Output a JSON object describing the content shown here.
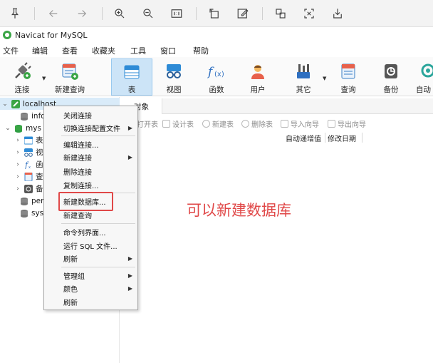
{
  "viewer_toolbar": {
    "icons": [
      "pin-icon",
      "back-icon",
      "forward-icon",
      "zoom-in-icon",
      "zoom-out-icon",
      "actual-size-icon",
      "rotate-icon",
      "edit-icon",
      "crop-icon",
      "fullscreen-icon",
      "save-icon"
    ]
  },
  "window": {
    "title": "Navicat for MySQL"
  },
  "menu": {
    "items": [
      "文件",
      "编辑",
      "查看",
      "收藏夹",
      "工具",
      "窗口",
      "帮助"
    ]
  },
  "ribbon": {
    "buttons": [
      {
        "label": "连接",
        "icon": "connect-icon"
      },
      {
        "label": "新建查询",
        "icon": "new-query-icon"
      },
      {
        "label": "表",
        "icon": "table-icon"
      },
      {
        "label": "视图",
        "icon": "view-icon"
      },
      {
        "label": "函数",
        "icon": "function-icon"
      },
      {
        "label": "用户",
        "icon": "user-icon"
      },
      {
        "label": "其它",
        "icon": "other-icon"
      },
      {
        "label": "查询",
        "icon": "query-icon"
      },
      {
        "label": "备份",
        "icon": "backup-icon"
      },
      {
        "label": "自动",
        "icon": "automation-icon"
      }
    ]
  },
  "tree": {
    "connection": "localhost",
    "items": [
      {
        "label": "info"
      },
      {
        "label": "mys"
      },
      {
        "label": "表"
      },
      {
        "label": "视"
      },
      {
        "label": "函"
      },
      {
        "label": "查"
      },
      {
        "label": "备"
      },
      {
        "label": "per"
      },
      {
        "label": "sys"
      }
    ]
  },
  "object_panel": {
    "tab": "对象",
    "toolbar": [
      "打开表",
      "设计表",
      "新建表",
      "删除表",
      "导入向导",
      "导出向导"
    ],
    "columns": [
      "自动递增值",
      "修改日期"
    ]
  },
  "context_menu": {
    "items": [
      "关闭连接",
      "切换连接配置文件",
      "编辑连接...",
      "新建连接",
      "删除连接",
      "复制连接...",
      "新建数据库...",
      "新建查询",
      "命令列界面...",
      "运行 SQL 文件...",
      "刷新",
      "管理组",
      "颜色",
      "刷新"
    ]
  },
  "annotation": {
    "text": "可以新建数据库",
    "color": "#e04848"
  },
  "colors": {
    "accent": "#cce4f7",
    "highlight": "#e04848"
  }
}
